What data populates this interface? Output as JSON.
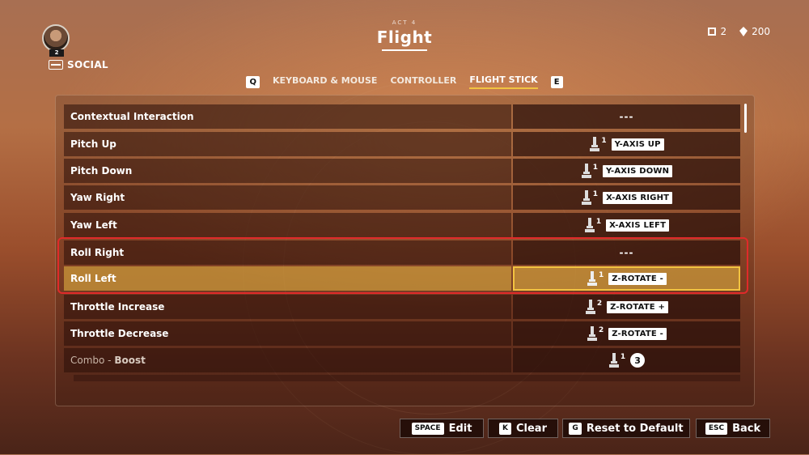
{
  "header": {
    "title_sub": "ACT 4",
    "title": "Flight",
    "player_level": "2",
    "social_label": "SOCIAL",
    "currency": [
      {
        "icon": "squad-icon",
        "value": "2"
      },
      {
        "icon": "gem-icon",
        "value": "200"
      }
    ]
  },
  "tabs": {
    "prev_key": "Q",
    "next_key": "E",
    "items": [
      {
        "label": "KEYBOARD & MOUSE",
        "active": false
      },
      {
        "label": "CONTROLLER",
        "active": false
      },
      {
        "label": "FLIGHT STICK",
        "active": true
      }
    ]
  },
  "bindings": [
    {
      "action": "Contextual Interaction",
      "device": "",
      "binding": "---"
    },
    {
      "action": "Pitch Up",
      "device": "1",
      "binding": "Y-AXIS UP"
    },
    {
      "action": "Pitch Down",
      "device": "1",
      "binding": "Y-AXIS DOWN"
    },
    {
      "action": "Yaw Right",
      "device": "1",
      "binding": "X-AXIS RIGHT"
    },
    {
      "action": "Yaw Left",
      "device": "1",
      "binding": "X-AXIS LEFT"
    },
    {
      "action": "Roll Right",
      "device": "",
      "binding": "---"
    },
    {
      "action": "Roll Left",
      "device": "1",
      "binding": "Z-ROTATE -",
      "selected": true
    },
    {
      "action": "Throttle Increase",
      "device": "2",
      "binding": "Z-ROTATE +"
    },
    {
      "action": "Throttle Decrease",
      "device": "2",
      "binding": "Z-ROTATE -"
    },
    {
      "action_prefix": "Combo - ",
      "action": "Boost",
      "device": "1",
      "binding": "3"
    }
  ],
  "footer": {
    "edit": {
      "key": "SPACE",
      "label": "Edit"
    },
    "clear": {
      "key": "K",
      "label": "Clear"
    },
    "reset": {
      "key": "G",
      "label": "Reset to Default"
    },
    "back": {
      "key": "ESC",
      "label": "Back"
    }
  },
  "colors": {
    "accent": "#f2c341",
    "highlight_outline": "#e02a2a"
  }
}
